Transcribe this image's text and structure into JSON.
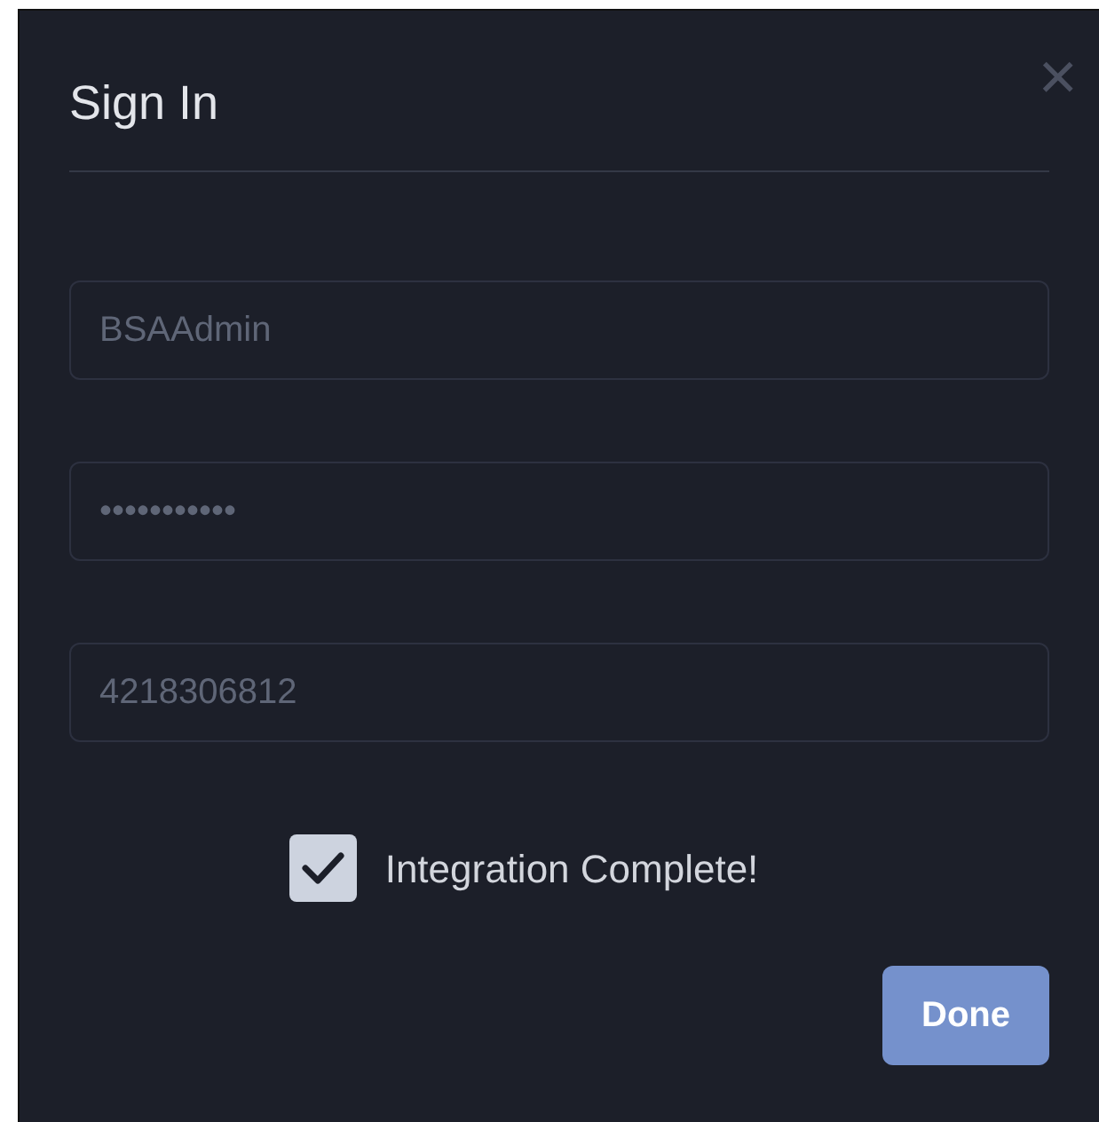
{
  "dialog": {
    "title": "Sign In",
    "close": "×"
  },
  "fields": [
    {
      "value": "BSAAdmin",
      "disabled": true
    },
    {
      "value": "•••••••••••",
      "disabled": true
    },
    {
      "value": "4218306812",
      "disabled": true
    }
  ],
  "checkbox": {
    "label": "Integration Complete!",
    "checked": true
  },
  "buttons": [
    {
      "label": "Done"
    }
  ]
}
